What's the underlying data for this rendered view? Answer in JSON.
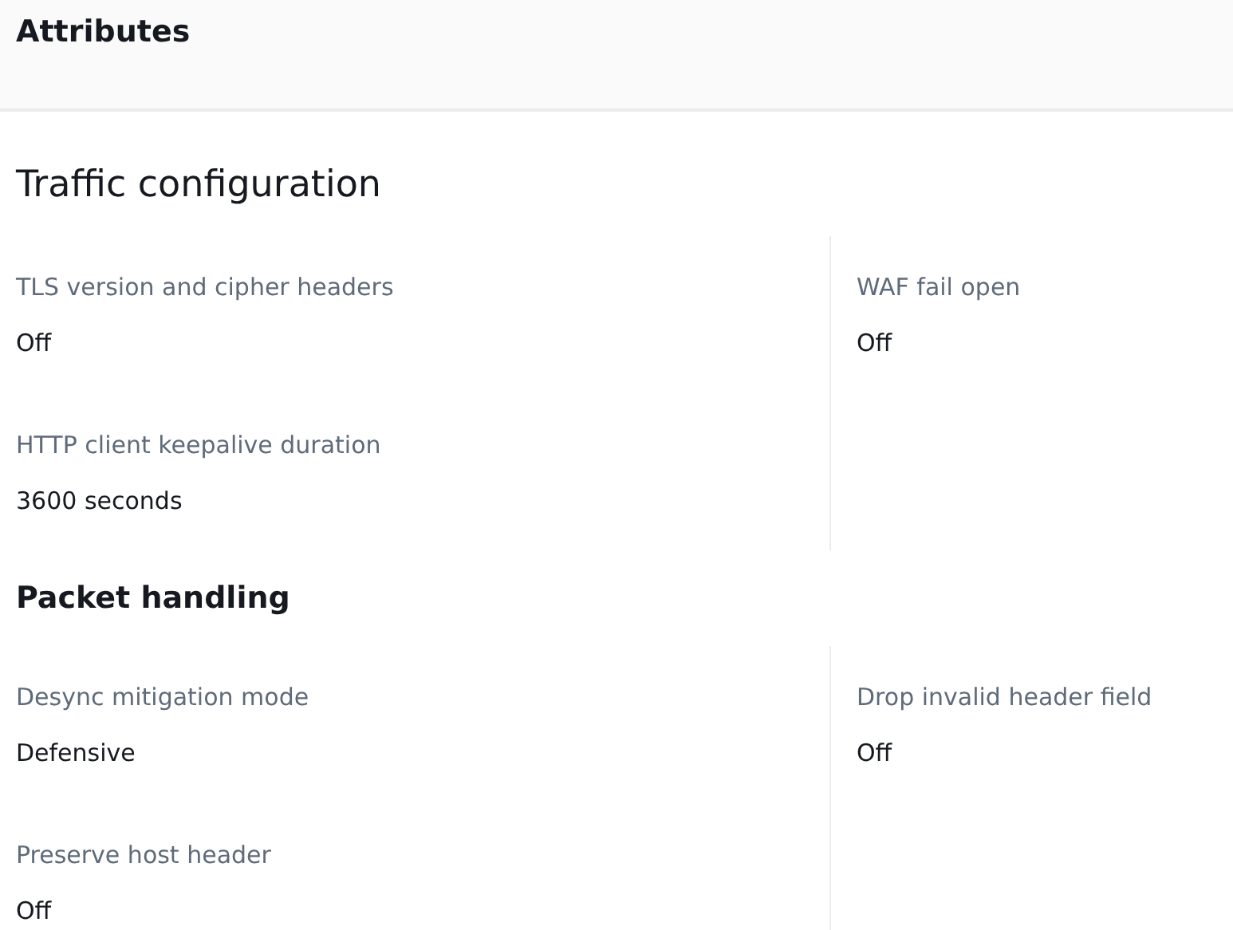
{
  "header": {
    "title": "Attributes"
  },
  "sections": [
    {
      "kind": "heading",
      "title": "Traffic configuration",
      "columns": [
        [
          {
            "label": "TLS version and cipher headers",
            "value": "Off"
          },
          {
            "label": "HTTP client keepalive duration",
            "value": "3600 seconds"
          }
        ],
        [
          {
            "label": "WAF fail open",
            "value": "Off"
          }
        ]
      ]
    },
    {
      "kind": "subheading",
      "title": "Packet handling",
      "columns": [
        [
          {
            "label": "Desync mitigation mode",
            "value": "Defensive"
          },
          {
            "label": "Preserve host header",
            "value": "Off"
          }
        ],
        [
          {
            "label": "Drop invalid header field",
            "value": "Off"
          }
        ]
      ]
    }
  ]
}
